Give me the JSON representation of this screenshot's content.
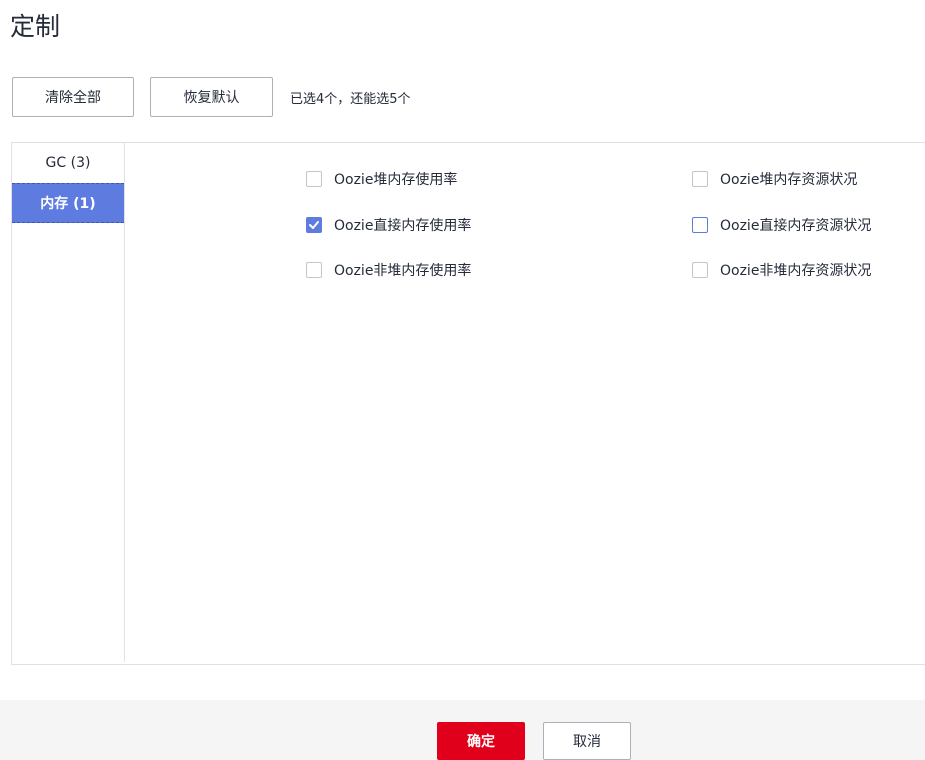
{
  "dialog": {
    "title": "定制"
  },
  "toolbar": {
    "clear_all_label": "清除全部",
    "restore_default_label": "恢复默认",
    "selection_hint": "已选4个，还能选5个"
  },
  "categories": [
    {
      "label": "GC (3)",
      "active": false
    },
    {
      "label": "内存 (1)",
      "active": true
    }
  ],
  "options": [
    {
      "label": "Oozie堆内存使用率",
      "checked": false
    },
    {
      "label": "Oozie堆内存资源状况",
      "checked": false
    },
    {
      "label": "Oozie直接内存使用率",
      "checked": true
    },
    {
      "label": "Oozie直接内存资源状况",
      "checked": false,
      "hover": true
    },
    {
      "label": "Oozie非堆内存使用率",
      "checked": false
    },
    {
      "label": "Oozie非堆内存资源状况",
      "checked": false
    }
  ],
  "footer": {
    "ok_label": "确定",
    "cancel_label": "取消"
  },
  "colors": {
    "accent": "#5e7ce0",
    "primary_button": "#e0001b"
  }
}
